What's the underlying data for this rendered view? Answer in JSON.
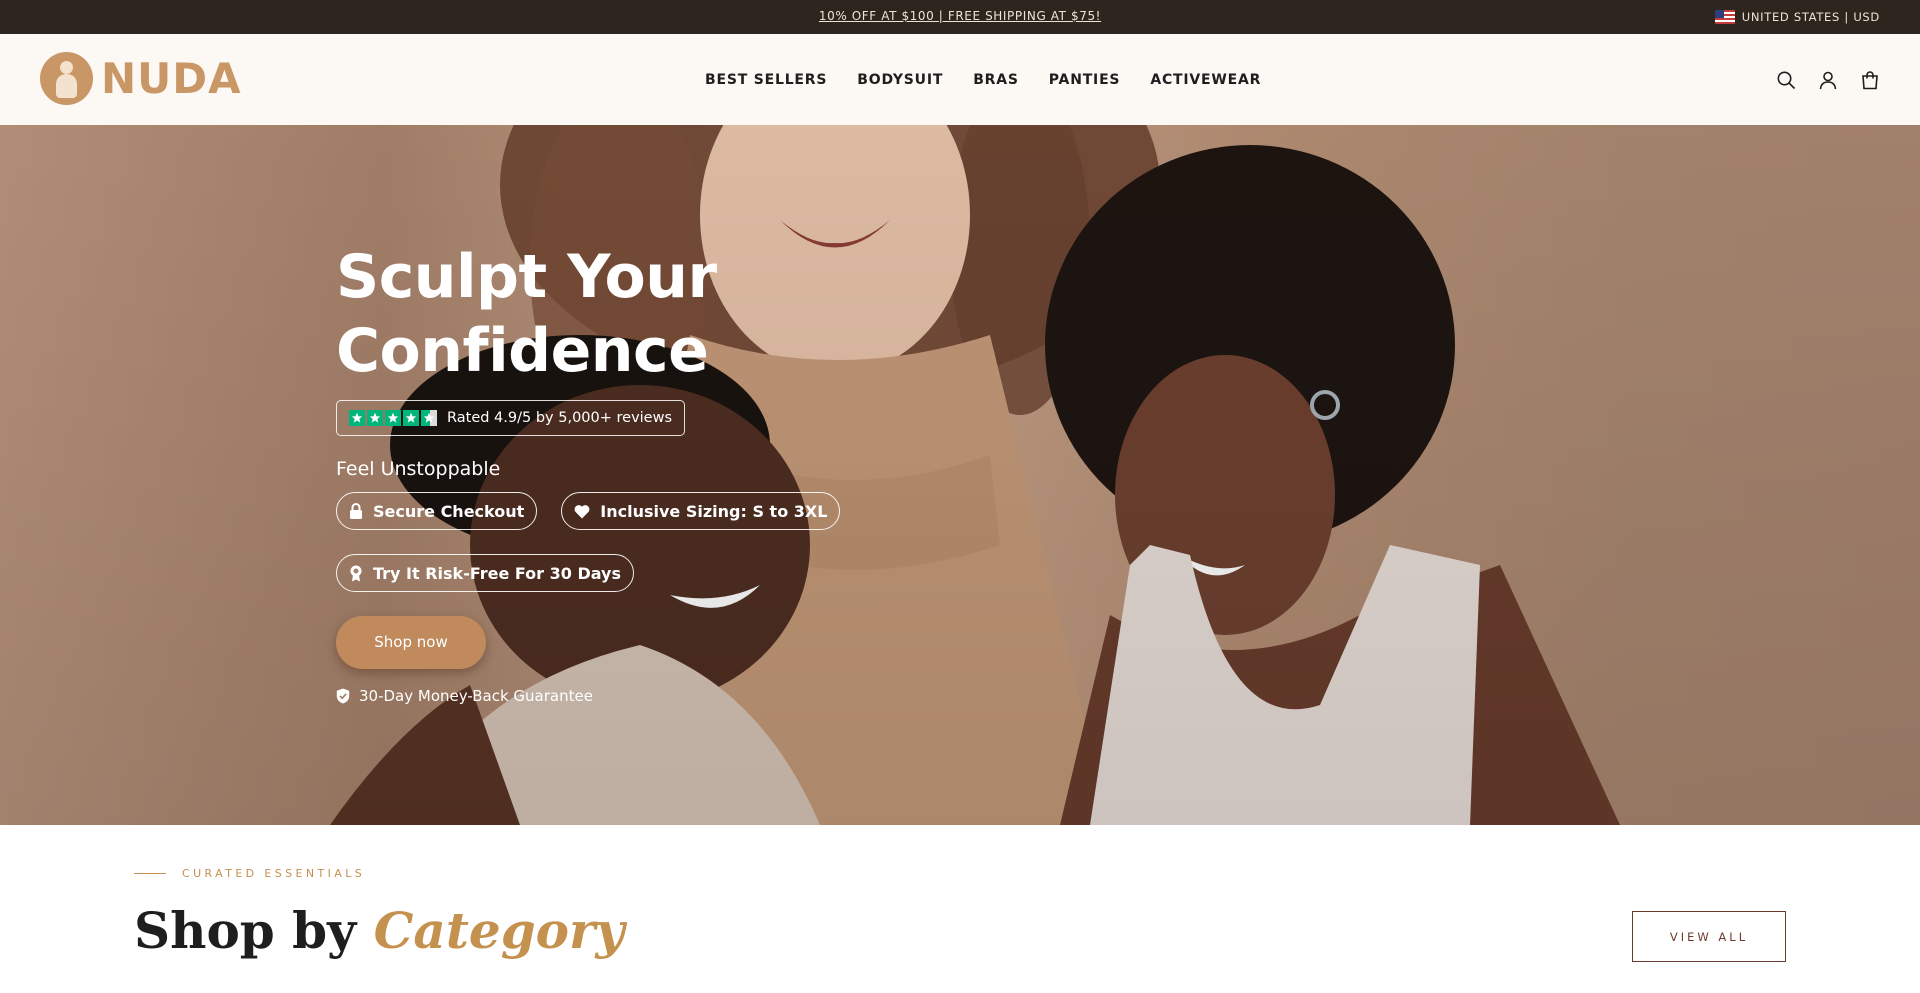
{
  "announcement": {
    "promo": "10% OFF AT $100 | FREE SHIPPING AT $75!",
    "locale": "UNITED STATES | USD"
  },
  "header": {
    "logo_text": "NUDA",
    "nav": [
      {
        "label": "BEST SELLERS"
      },
      {
        "label": "BODYSUIT"
      },
      {
        "label": "BRAS"
      },
      {
        "label": "PANTIES"
      },
      {
        "label": "ACTIVEWEAR"
      }
    ],
    "icons": [
      "search-icon",
      "account-icon",
      "cart-icon"
    ]
  },
  "hero": {
    "title_line1": "Sculpt Your",
    "title_line2": "Confidence",
    "rating_text": "Rated 4.9/5 by 5,000+ reviews",
    "rating_stars": 4.5,
    "subtitle": "Feel Unstoppable",
    "badges": [
      {
        "label": "Secure Checkout",
        "icon": "lock-icon"
      },
      {
        "label": "Inclusive Sizing: S to 3XL",
        "icon": "heart-icon"
      },
      {
        "label": "Try It Risk-Free For 30 Days",
        "icon": "award-icon"
      }
    ],
    "cta_label": "Shop now",
    "guarantee": "30-Day Money-Back Guarantee"
  },
  "category_section": {
    "eyebrow": "CURATED ESSENTIALS",
    "title_plain": "Shop by",
    "title_accent": "Category",
    "view_all": "VIEW ALL"
  },
  "colors": {
    "topbar_bg": "#2d261f",
    "header_bg": "#fcf8f3",
    "brand": "#c99666",
    "cta": "#c08a5c",
    "accent_gold": "#c4914f",
    "trustpilot_green": "#00b67a"
  }
}
